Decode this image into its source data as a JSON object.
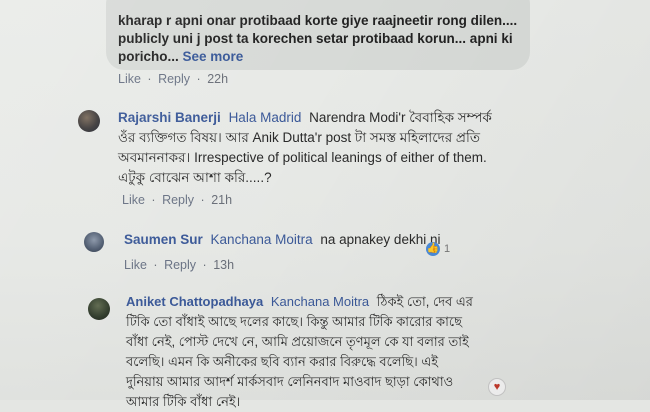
{
  "top_comment": {
    "lines": [
      "kharap r apni onar protibaad korte giye raajneetir rong dilen....",
      "publicly uni j post ta korechen setar protibaad korun... apni ki",
      "poricho..."
    ],
    "see_more": "See more",
    "like": "Like",
    "reply": "Reply",
    "time": "22h"
  },
  "comments": [
    {
      "author": "Rajarshi Banerji",
      "mention": "Hala Madrid",
      "text_lines": [
        "Narendra Modi'r বৈবাহিক সম্পর্ক",
        "ওঁর ব্যক্তিগত বিষয়। আর Anik Dutta'r post টা সমস্ত মহিলাদের প্রতি",
        "অবমাননাকর। Irrespective of political leanings of either of them.",
        "এটুকু বোঝেন আশা করি.....?"
      ],
      "like": "Like",
      "reply": "Reply",
      "time": "21h"
    },
    {
      "author": "Saumen Sur",
      "mention": "Kanchana Moitra",
      "text_lines": [
        "na apnakey dekhi ni"
      ],
      "reaction_count": "1",
      "like": "Like",
      "reply": "Reply",
      "time": "13h"
    },
    {
      "author": "Aniket Chattopadhaya",
      "mention": "Kanchana Moitra",
      "text_lines": [
        "ঠিকই তো, দেব এর",
        "টিকি তো বাঁধাই আছে দলের কাছে। কিন্তু আমার টিকি কারোর কাছে",
        "বাঁধা নেই, পোস্ট দেখে নে, আমি প্রয়োজনে তৃণমূল কে যা বলার তাই",
        "বলেছি। এমন কি অনীকের ছবি ব্যান করার বিরুদ্ধে বলেছি। এই",
        "দুনিয়ায় আমার আদর্শ মার্কসবাদ লেনিনবাদ মাওবাদ ছাড়া কোথাও",
        "আমার টিকি বাঁধা নেই।"
      ]
    }
  ],
  "colors": {
    "link": "#3b5998",
    "action": "#6a7385",
    "bubble": "#d7dad7"
  },
  "icons": {
    "reaction": "like-reaction-icon",
    "heart": "heart-reaction-icon"
  }
}
